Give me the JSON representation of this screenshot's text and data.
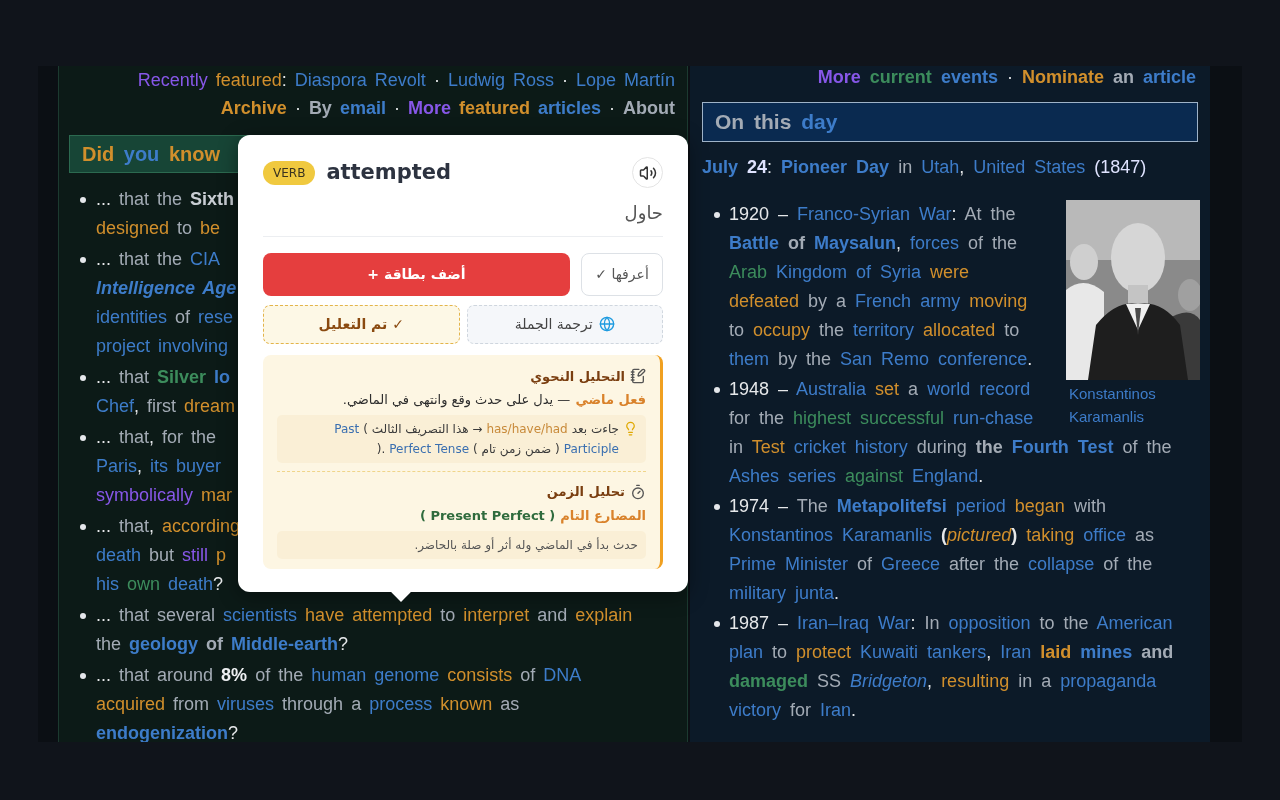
{
  "left_column": {
    "header_lines": [
      [
        {
          "text": "Recently",
          "color": "#8757e8",
          "kind": "plain"
        },
        {
          "text": " featured",
          "color": "#d18f2c",
          "kind": "plain"
        },
        {
          "text": ": ",
          "kind": "plain"
        },
        {
          "text": "Diaspora Revolt",
          "color": "#3d7cc9",
          "kind": "plain"
        },
        {
          "text": " · ",
          "kind": "plain"
        },
        {
          "text": "Ludwig Ross",
          "color": "#3d7cc9",
          "kind": "plain"
        },
        {
          "text": " · ",
          "kind": "plain"
        },
        {
          "text": "Lope Martín",
          "color": "#3d7cc9",
          "kind": "plain"
        }
      ],
      [
        {
          "text": "Archive",
          "color": "#d18f2c",
          "kind": "bold"
        },
        {
          "text": " · ",
          "kind": "plain"
        },
        {
          "text": "By",
          "color": "#a3abb5",
          "kind": "bold"
        },
        {
          "text": " email",
          "color": "#3d7cc9",
          "kind": "bold"
        },
        {
          "text": " · ",
          "kind": "plain"
        },
        {
          "text": "More",
          "color": "#8757e8",
          "kind": "bold"
        },
        {
          "text": " featured",
          "color": "#d18f2c",
          "kind": "bold"
        },
        {
          "text": " articles",
          "color": "#3d7cc9",
          "kind": "bold"
        },
        {
          "text": " · ",
          "kind": "plain"
        },
        {
          "text": "About",
          "color": "#a3abb5",
          "kind": "bold"
        }
      ]
    ],
    "section_title": [
      {
        "text": "Did",
        "color": "#d18f2c"
      },
      {
        "text": " you",
        "color": "#3d7cc9"
      },
      {
        "text": " know",
        "color": "#d18f2c"
      }
    ],
    "items": [
      {
        "lines": [
          [
            {
              "text": "... ",
              "kind": "plain"
            },
            {
              "text": "that the",
              "color": "#a3abb5",
              "kind": "plain"
            },
            {
              "text": " Sixth",
              "color": "#c9ced4",
              "kind": "bold"
            }
          ],
          [
            {
              "text": "designed",
              "color": "#d18f2c",
              "kind": "plain"
            },
            {
              "text": " to",
              "color": "#a3abb5",
              "kind": "plain"
            },
            {
              "text": " be",
              "color": "#d18f2c",
              "kind": "plain"
            }
          ]
        ]
      },
      {
        "lines": [
          [
            {
              "text": "... ",
              "kind": "plain"
            },
            {
              "text": "that the",
              "color": "#a3abb5",
              "kind": "plain"
            },
            {
              "text": " CIA",
              "color": "#3d7cc9",
              "kind": "plain"
            }
          ],
          [
            {
              "text": "Intelligence Age",
              "color": "#3d7cc9",
              "kind": "bold-italic"
            }
          ],
          [
            {
              "text": "identities",
              "color": "#3d7cc9",
              "kind": "plain"
            },
            {
              "text": " of",
              "color": "#a3abb5",
              "kind": "plain"
            },
            {
              "text": " rese",
              "color": "#3d7cc9",
              "kind": "plain"
            }
          ],
          [
            {
              "text": "project involving",
              "color": "#3d7cc9",
              "kind": "plain"
            }
          ]
        ]
      },
      {
        "lines": [
          [
            {
              "text": "... ",
              "kind": "plain"
            },
            {
              "text": "that",
              "color": "#a3abb5",
              "kind": "plain"
            },
            {
              "text": " Silver",
              "color": "#3c8c5c",
              "kind": "bold"
            },
            {
              "text": " lo",
              "color": "#3d7cc9",
              "kind": "bold"
            }
          ],
          [
            {
              "text": "Chef",
              "color": "#3d7cc9",
              "kind": "plain"
            },
            {
              "text": ", ",
              "kind": "plain"
            },
            {
              "text": "first",
              "color": "#a3abb5",
              "kind": "plain"
            },
            {
              "text": " dream",
              "color": "#d18f2c",
              "kind": "plain"
            }
          ]
        ]
      },
      {
        "lines": [
          [
            {
              "text": "... ",
              "kind": "plain"
            },
            {
              "text": "that",
              "color": "#a3abb5",
              "kind": "plain"
            },
            {
              "text": ", ",
              "kind": "plain"
            },
            {
              "text": "for the",
              "color": "#a3abb5",
              "kind": "plain"
            }
          ],
          [
            {
              "text": "Paris",
              "color": "#3d7cc9",
              "kind": "plain"
            },
            {
              "text": ", ",
              "kind": "plain"
            },
            {
              "text": "its buyer",
              "color": "#3d7cc9",
              "kind": "plain"
            }
          ],
          [
            {
              "text": "symbolically",
              "color": "#8757e8",
              "kind": "plain"
            },
            {
              "text": " mar",
              "color": "#d18f2c",
              "kind": "plain"
            }
          ]
        ]
      },
      {
        "lines": [
          [
            {
              "text": "... ",
              "kind": "plain"
            },
            {
              "text": "that",
              "color": "#a3abb5",
              "kind": "plain"
            },
            {
              "text": ", ",
              "kind": "plain"
            },
            {
              "text": "according",
              "color": "#d18f2c",
              "kind": "plain"
            }
          ],
          [
            {
              "text": "death",
              "color": "#3d7cc9",
              "kind": "plain"
            },
            {
              "text": " but",
              "color": "#a3abb5",
              "kind": "plain"
            },
            {
              "text": " still",
              "color": "#8757e8",
              "kind": "plain"
            },
            {
              "text": " p",
              "color": "#d18f2c",
              "kind": "plain"
            }
          ],
          [
            {
              "text": "his",
              "color": "#3d7cc9",
              "kind": "plain"
            },
            {
              "text": " own",
              "color": "#3c8c5c",
              "kind": "plain"
            },
            {
              "text": " death",
              "color": "#3d7cc9",
              "kind": "plain"
            },
            {
              "text": "?",
              "kind": "plain"
            }
          ]
        ]
      },
      {
        "lines": [
          [
            {
              "text": "... ",
              "kind": "plain"
            },
            {
              "text": "that several",
              "color": "#a3abb5",
              "kind": "plain"
            },
            {
              "text": " scientists",
              "color": "#3d7cc9",
              "kind": "plain"
            },
            {
              "text": " have attempted",
              "color": "#d18f2c",
              "kind": "plain"
            },
            {
              "text": " to",
              "color": "#a3abb5",
              "kind": "plain"
            },
            {
              "text": " interpret",
              "color": "#d18f2c",
              "kind": "plain"
            },
            {
              "text": " and",
              "color": "#a3abb5",
              "kind": "plain"
            },
            {
              "text": " explain",
              "color": "#d18f2c",
              "kind": "plain"
            }
          ],
          [
            {
              "text": "the",
              "color": "#a3abb5",
              "kind": "plain"
            },
            {
              "text": " geology",
              "color": "#3d7cc9",
              "kind": "bold"
            },
            {
              "text": " of",
              "color": "#a3abb5",
              "kind": "bold"
            },
            {
              "text": " Middle-earth",
              "color": "#3d7cc9",
              "kind": "bold"
            },
            {
              "text": "?",
              "kind": "plain"
            }
          ]
        ]
      },
      {
        "lines": [
          [
            {
              "text": "... ",
              "kind": "plain"
            },
            {
              "text": "that around",
              "color": "#a3abb5",
              "kind": "plain"
            },
            {
              "text": " 8%",
              "color": "#eef0f2",
              "kind": "bold"
            },
            {
              "text": " of the",
              "color": "#a3abb5",
              "kind": "plain"
            },
            {
              "text": " human genome",
              "color": "#3d7cc9",
              "kind": "plain"
            },
            {
              "text": " consists",
              "color": "#d18f2c",
              "kind": "plain"
            },
            {
              "text": " of",
              "color": "#a3abb5",
              "kind": "plain"
            },
            {
              "text": " DNA",
              "color": "#3d7cc9",
              "kind": "plain"
            }
          ],
          [
            {
              "text": "acquired",
              "color": "#d18f2c",
              "kind": "plain"
            },
            {
              "text": " from",
              "color": "#a3abb5",
              "kind": "plain"
            },
            {
              "text": " viruses",
              "color": "#3d7cc9",
              "kind": "plain"
            },
            {
              "text": " through a",
              "color": "#a3abb5",
              "kind": "plain"
            },
            {
              "text": " process",
              "color": "#3d7cc9",
              "kind": "plain"
            },
            {
              "text": " known",
              "color": "#d18f2c",
              "kind": "plain"
            },
            {
              "text": " as",
              "color": "#a3abb5",
              "kind": "plain"
            }
          ],
          [
            {
              "text": "endogenization",
              "color": "#3d7cc9",
              "kind": "bold"
            },
            {
              "text": "?",
              "kind": "plain"
            }
          ]
        ]
      }
    ]
  },
  "right_column": {
    "header_lines": [
      [
        {
          "text": "More",
          "color": "#8757e8",
          "kind": "bold"
        },
        {
          "text": " current",
          "color": "#3c8c5c",
          "kind": "bold"
        },
        {
          "text": " events",
          "color": "#3d7cc9",
          "kind": "bold"
        },
        {
          "text": " · ",
          "kind": "plain"
        },
        {
          "text": "Nominate",
          "color": "#d18f2c",
          "kind": "bold"
        },
        {
          "text": " an",
          "color": "#a3abb5",
          "kind": "bold"
        },
        {
          "text": " article",
          "color": "#3d7cc9",
          "kind": "bold"
        }
      ]
    ],
    "section_title": [
      {
        "text": "On this",
        "color": "#a3abb5"
      },
      {
        "text": " day",
        "color": "#3d7cc9"
      }
    ],
    "date_line": [
      {
        "text": "July",
        "color": "#3d7cc9",
        "kind": "bold"
      },
      {
        "text": " 24",
        "color": "#dfe3ff",
        "kind": "bold"
      },
      {
        "text": ": ",
        "kind": "plain"
      },
      {
        "text": "Pioneer Day",
        "color": "#3d7cc9",
        "kind": "bold"
      },
      {
        "text": " in",
        "color": "#a3abb5",
        "kind": "plain"
      },
      {
        "text": " Utah",
        "color": "#3d7cc9",
        "kind": "plain"
      },
      {
        "text": ", ",
        "kind": "plain"
      },
      {
        "text": "United States",
        "color": "#3d7cc9",
        "kind": "plain"
      },
      {
        "text": " (1847)",
        "color": "#dfe3ff",
        "kind": "plain"
      }
    ],
    "figure": {
      "kind": "picture",
      "caption": "Konstantinos Karamanlis"
    },
    "items": [
      {
        "lines": [
          [
            {
              "text": "1920 – ",
              "kind": "plain"
            },
            {
              "text": "Franco-Syrian War",
              "color": "#3d7cc9",
              "kind": "plain"
            },
            {
              "text": ": ",
              "kind": "plain"
            },
            {
              "text": "At the",
              "color": "#a3abb5",
              "kind": "plain"
            }
          ],
          [
            {
              "text": "Battle",
              "color": "#3d7cc9",
              "kind": "bold"
            },
            {
              "text": " of",
              "color": "#a3abb5",
              "kind": "bold"
            },
            {
              "text": " Maysalun",
              "color": "#3d7cc9",
              "kind": "bold"
            },
            {
              "text": ", ",
              "kind": "plain"
            },
            {
              "text": "forces",
              "color": "#3d7cc9",
              "kind": "plain"
            },
            {
              "text": " of the",
              "color": "#a3abb5",
              "kind": "plain"
            }
          ],
          [
            {
              "text": "Arab",
              "color": "#3c8c5c",
              "kind": "plain"
            },
            {
              "text": " Kingdom of Syria",
              "color": "#3d7cc9",
              "kind": "plain"
            },
            {
              "text": " were",
              "color": "#d18f2c",
              "kind": "plain"
            }
          ],
          [
            {
              "text": "defeated",
              "color": "#d18f2c",
              "kind": "plain"
            },
            {
              "text": " by a",
              "color": "#a3abb5",
              "kind": "plain"
            },
            {
              "text": " French army",
              "color": "#3d7cc9",
              "kind": "plain"
            },
            {
              "text": " moving",
              "color": "#d18f2c",
              "kind": "plain"
            }
          ],
          [
            {
              "text": "to",
              "color": "#a3abb5",
              "kind": "plain"
            },
            {
              "text": " occupy",
              "color": "#d18f2c",
              "kind": "plain"
            },
            {
              "text": " the",
              "color": "#a3abb5",
              "kind": "plain"
            },
            {
              "text": " territory",
              "color": "#3d7cc9",
              "kind": "plain"
            },
            {
              "text": " allocated",
              "color": "#d18f2c",
              "kind": "plain"
            },
            {
              "text": " to",
              "color": "#a3abb5",
              "kind": "plain"
            }
          ],
          [
            {
              "text": "them",
              "color": "#3d7cc9",
              "kind": "plain"
            },
            {
              "text": " by the",
              "color": "#a3abb5",
              "kind": "plain"
            },
            {
              "text": " San Remo conference",
              "color": "#3d7cc9",
              "kind": "plain"
            },
            {
              "text": ".",
              "kind": "plain"
            }
          ]
        ]
      },
      {
        "lines": [
          [
            {
              "text": "1948 – ",
              "kind": "plain"
            },
            {
              "text": "Australia",
              "color": "#3d7cc9",
              "kind": "plain"
            },
            {
              "text": " set",
              "color": "#d18f2c",
              "kind": "plain"
            },
            {
              "text": " a",
              "color": "#a3abb5",
              "kind": "plain"
            },
            {
              "text": " world record",
              "color": "#3d7cc9",
              "kind": "plain"
            }
          ],
          [
            {
              "text": "for the",
              "color": "#a3abb5",
              "kind": "plain"
            },
            {
              "text": " highest successful",
              "color": "#3c8c5c",
              "kind": "plain"
            },
            {
              "text": " run-chase",
              "color": "#3d7cc9",
              "kind": "plain"
            }
          ],
          [
            {
              "text": "in",
              "color": "#a3abb5",
              "kind": "plain"
            },
            {
              "text": " Test",
              "color": "#d18f2c",
              "kind": "plain"
            },
            {
              "text": " cricket history",
              "color": "#3d7cc9",
              "kind": "plain"
            },
            {
              "text": " during",
              "color": "#a3abb5",
              "kind": "plain"
            },
            {
              "text": " the",
              "color": "#a3abb5",
              "kind": "bold"
            },
            {
              "text": " Fourth Test",
              "color": "#3d7cc9",
              "kind": "bold"
            },
            {
              "text": " of the",
              "color": "#a3abb5",
              "kind": "plain"
            }
          ],
          [
            {
              "text": "Ashes series",
              "color": "#3d7cc9",
              "kind": "plain"
            },
            {
              "text": " against",
              "color": "#3c8c5c",
              "kind": "plain"
            },
            {
              "text": " England",
              "color": "#3d7cc9",
              "kind": "plain"
            },
            {
              "text": ".",
              "kind": "plain"
            }
          ]
        ]
      },
      {
        "lines": [
          [
            {
              "text": "1974 – ",
              "kind": "plain"
            },
            {
              "text": "The",
              "color": "#a3abb5",
              "kind": "plain"
            },
            {
              "text": " Metapolitefsi",
              "color": "#3d7cc9",
              "kind": "bold"
            },
            {
              "text": " period",
              "color": "#3d7cc9",
              "kind": "plain"
            },
            {
              "text": " began",
              "color": "#d18f2c",
              "kind": "plain"
            },
            {
              "text": " with",
              "color": "#a3abb5",
              "kind": "plain"
            }
          ],
          [
            {
              "text": "Konstantinos Karamanlis",
              "color": "#3d7cc9",
              "kind": "plain"
            },
            {
              "text": " (",
              "kind": "bold"
            },
            {
              "text": "pictured",
              "color": "#d18f2c",
              "kind": "italic"
            },
            {
              "text": ")",
              "kind": "bold"
            },
            {
              "text": " taking",
              "color": "#d18f2c",
              "kind": "plain"
            },
            {
              "text": " office",
              "color": "#3d7cc9",
              "kind": "plain"
            },
            {
              "text": " as",
              "color": "#a3abb5",
              "kind": "plain"
            }
          ],
          [
            {
              "text": "Prime Minister",
              "color": "#3d7cc9",
              "kind": "plain"
            },
            {
              "text": " of",
              "color": "#a3abb5",
              "kind": "plain"
            },
            {
              "text": " Greece",
              "color": "#3d7cc9",
              "kind": "plain"
            },
            {
              "text": " after the",
              "color": "#a3abb5",
              "kind": "plain"
            },
            {
              "text": " collapse",
              "color": "#3d7cc9",
              "kind": "plain"
            },
            {
              "text": " of the",
              "color": "#a3abb5",
              "kind": "plain"
            }
          ],
          [
            {
              "text": "military junta",
              "color": "#3d7cc9",
              "kind": "plain"
            },
            {
              "text": ".",
              "kind": "plain"
            }
          ]
        ]
      },
      {
        "lines": [
          [
            {
              "text": "1987 – ",
              "kind": "plain"
            },
            {
              "text": "Iran–Iraq War",
              "color": "#3d7cc9",
              "kind": "plain"
            },
            {
              "text": ": ",
              "kind": "plain"
            },
            {
              "text": "In",
              "color": "#a3abb5",
              "kind": "plain"
            },
            {
              "text": " opposition",
              "color": "#3d7cc9",
              "kind": "plain"
            },
            {
              "text": " to the",
              "color": "#a3abb5",
              "kind": "plain"
            },
            {
              "text": " American",
              "color": "#3d7cc9",
              "kind": "plain"
            }
          ],
          [
            {
              "text": "plan",
              "color": "#3d7cc9",
              "kind": "plain"
            },
            {
              "text": " to",
              "color": "#a3abb5",
              "kind": "plain"
            },
            {
              "text": " protect",
              "color": "#d18f2c",
              "kind": "plain"
            },
            {
              "text": " Kuwaiti tankers",
              "color": "#3d7cc9",
              "kind": "plain"
            },
            {
              "text": ", ",
              "kind": "plain"
            },
            {
              "text": "Iran",
              "color": "#3d7cc9",
              "kind": "plain"
            },
            {
              "text": " laid",
              "color": "#d18f2c",
              "kind": "bold"
            },
            {
              "text": " mines",
              "color": "#3d7cc9",
              "kind": "bold"
            },
            {
              "text": " and",
              "color": "#a3abb5",
              "kind": "bold"
            }
          ],
          [
            {
              "text": "damaged",
              "color": "#3c8c5c",
              "kind": "bold"
            },
            {
              "text": " SS",
              "color": "#a3abb5",
              "kind": "plain"
            },
            {
              "text": " Bridgeton",
              "color": "#3d7cc9",
              "kind": "italic"
            },
            {
              "text": ", ",
              "kind": "plain"
            },
            {
              "text": "resulting",
              "color": "#d18f2c",
              "kind": "plain"
            },
            {
              "text": " in a",
              "color": "#a3abb5",
              "kind": "plain"
            },
            {
              "text": " propaganda",
              "color": "#3d7cc9",
              "kind": "plain"
            }
          ],
          [
            {
              "text": "victory",
              "color": "#3d7cc9",
              "kind": "plain"
            },
            {
              "text": " for",
              "color": "#a3abb5",
              "kind": "plain"
            },
            {
              "text": " Iran",
              "color": "#3d7cc9",
              "kind": "plain"
            },
            {
              "text": ".",
              "kind": "plain"
            }
          ]
        ]
      }
    ]
  },
  "popup": {
    "part_of_speech": "VERB",
    "word": "attempted",
    "translation": "حاول",
    "buttons": [
      {
        "kind": "known",
        "label": "✓ أعرفها"
      },
      {
        "kind": "add",
        "label": "+ أضف بطاقة"
      }
    ],
    "toggles": [
      {
        "kind": "translate",
        "label": "ترجمة الجملة"
      },
      {
        "kind": "analyzed",
        "label": "تم التعليل ✓"
      }
    ],
    "sections": [
      {
        "kind": "grammar",
        "title": "التحليل النحوي",
        "line": [
          {
            "text": "فعل ماضي",
            "color": "#d9822b",
            "kind": "bold"
          },
          {
            "text": "— يدل على حدث وقع وانتهى في الماضي.",
            "color": "#2d2d2d",
            "kind": "plain"
          }
        ],
        "note_lines": [
          [
            {
              "text": "Past",
              "color": "#3a6fb0"
            },
            {
              "text": "( هذا التصريف الثالث →",
              "color": "#3a3a3a"
            },
            {
              "text": "has/have/had",
              "color": "#c88a3a"
            },
            {
              "text": "جاءت بعد",
              "color": "#3a3a3a"
            }
          ],
          [
            {
              "text": ").",
              "color": "#3a3a3a"
            },
            {
              "text": "Perfect Tense",
              "color": "#3a6fb0"
            },
            {
              "text": "( ضمن زمن تام )",
              "color": "#3a3a3a"
            },
            {
              "text": "Participle",
              "color": "#3a6fb0"
            }
          ]
        ]
      },
      {
        "kind": "tense",
        "title": "تحليل الزمن",
        "line": [
          {
            "text": "( Present Perfect )",
            "color": "#2f6b3d"
          },
          {
            "text": "المضارع التام",
            "color": "#d9822b"
          }
        ],
        "note_lines": [
          [
            {
              "text": "حدث بدأ في الماضي وله أثر أو صلة بالحاضر.",
              "color": "#555555"
            }
          ]
        ]
      }
    ]
  }
}
